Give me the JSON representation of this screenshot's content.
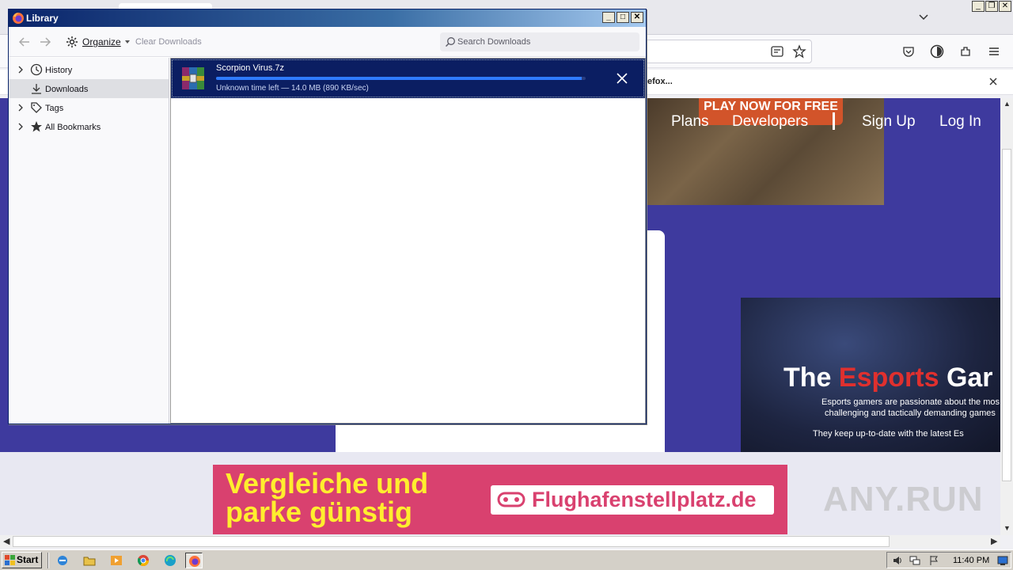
{
  "browser": {
    "notification_text": "efox...",
    "site": {
      "nav": [
        "Plans",
        "Developers",
        "Sign Up",
        "Log In"
      ],
      "game_banner_text": "PLAY NOW FOR FREE",
      "esports": {
        "headline_part1": "The ",
        "headline_part2": "Esports",
        "headline_part3": " Gar",
        "line1": "Esports gamers are passionate about the mos",
        "line2": "challenging and tactically demanding games",
        "line3": "They keep up-to-date with the latest Es"
      },
      "ad": {
        "text_line1": "Vergleiche und",
        "text_line2": "parke günstig",
        "brand": "Flughafenstellplatz.de"
      }
    },
    "watermark": "ANY.RUN"
  },
  "library": {
    "title": "Library",
    "toolbar": {
      "organize_label": "Organize",
      "clear_label": "Clear Downloads",
      "search_placeholder": "Search Downloads"
    },
    "sidebar": {
      "items": [
        {
          "label": "History",
          "icon": "clock-icon",
          "expandable": true,
          "selected": false
        },
        {
          "label": "Downloads",
          "icon": "download-icon",
          "expandable": false,
          "selected": true
        },
        {
          "label": "Tags",
          "icon": "tag-icon",
          "expandable": true,
          "selected": false
        },
        {
          "label": "All Bookmarks",
          "icon": "star-icon",
          "expandable": true,
          "selected": false
        }
      ]
    },
    "downloads": [
      {
        "filename": "Scorpion Virus.7z",
        "status": "Unknown time left — 14.0 MB (890 KB/sec)",
        "progress_fraction": 0.99,
        "icon": "winrar-archive-icon"
      }
    ]
  },
  "taskbar": {
    "start_label": "Start",
    "clock": "11:40 PM",
    "apps": [
      "internet-explorer-icon",
      "folder-icon",
      "media-player-icon",
      "chrome-icon",
      "edge-icon",
      "firefox-icon"
    ]
  },
  "colors": {
    "site_purple": "#3e3a9e",
    "download_selected_bg": "#0b1e62",
    "progress_fill": "#2f7bff",
    "ad_pink": "#d9416f",
    "ad_yellow": "#ffee2e"
  }
}
